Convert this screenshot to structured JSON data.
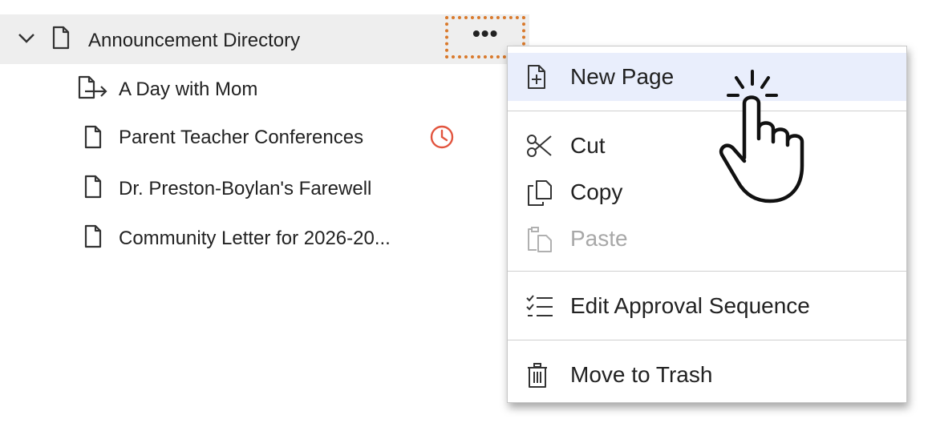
{
  "tree": {
    "parent_label": "Announcement Directory",
    "more_label": "•••",
    "children": [
      {
        "label": "A Day with Mom",
        "icon": "page-redirect-icon"
      },
      {
        "label": "Parent Teacher Conferences",
        "icon": "page-icon",
        "badge": "clock-icon"
      },
      {
        "label": "Dr. Preston-Boylan's Farewell",
        "icon": "page-icon"
      },
      {
        "label": "Community Letter for 2026-20...",
        "icon": "page-icon"
      }
    ]
  },
  "menu": {
    "items": [
      {
        "label": "New Page",
        "icon": "new-page-icon"
      },
      {
        "label": "Cut",
        "icon": "scissors-icon"
      },
      {
        "label": "Copy",
        "icon": "copy-icon"
      },
      {
        "label": "Paste",
        "icon": "paste-icon",
        "disabled": true
      },
      {
        "label": "Edit Approval Sequence",
        "icon": "approval-list-icon"
      },
      {
        "label": "Move to Trash",
        "icon": "trash-icon"
      }
    ]
  },
  "colors": {
    "highlight_border": "#d9792b",
    "hover_bg": "#e9eefc",
    "badge": "#e2553f",
    "row_bg": "#eeeeee"
  }
}
